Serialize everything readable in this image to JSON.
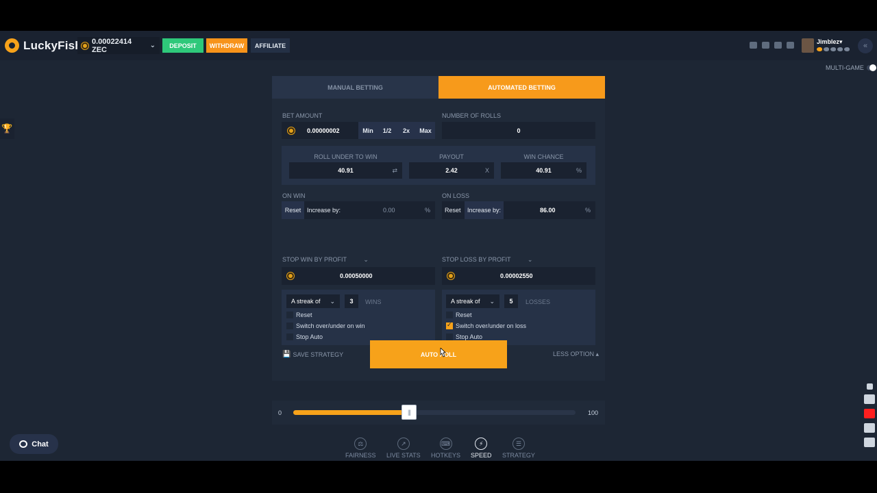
{
  "header": {
    "logo": "LuckyFish",
    "balance": "0.00022414 ZEC",
    "deposit": "DEPOSIT",
    "withdraw": "WITHDRAW",
    "affiliate": "AFFILIATE",
    "username": "Jimblez",
    "multigame": "MULTI-GAME"
  },
  "tabs": {
    "manual": "MANUAL BETTING",
    "auto": "AUTOMATED BETTING"
  },
  "bet": {
    "amount_label": "BET AMOUNT",
    "amount": "0.00000002",
    "quick": [
      "Min",
      "1/2",
      "2x",
      "Max"
    ],
    "rolls_label": "NUMBER OF ROLLS",
    "rolls": "0"
  },
  "roll": {
    "roll_under_label": "ROLL UNDER TO WIN",
    "roll_under": "40.91",
    "payout_label": "PAYOUT",
    "payout": "2.42",
    "payout_suffix": "X",
    "chance_label": "WIN CHANCE",
    "chance": "40.91",
    "chance_suffix": "%"
  },
  "on_win": {
    "label": "ON WIN",
    "reset": "Reset",
    "increase": "Increase by:",
    "value": "0.00",
    "suffix": "%"
  },
  "on_loss": {
    "label": "ON LOSS",
    "reset": "Reset",
    "increase": "Increase by:",
    "value": "86.00",
    "suffix": "%"
  },
  "stop_win": {
    "label": "STOP WIN BY PROFIT",
    "value": "0.00050000"
  },
  "stop_loss": {
    "label": "STOP LOSS BY PROFIT",
    "value": "0.00002550"
  },
  "streak_win": {
    "select": "A streak of",
    "count": "3",
    "unit": "WINS",
    "options": [
      {
        "label": "Reset",
        "checked": false
      },
      {
        "label": "Switch over/under on win",
        "checked": false
      },
      {
        "label": "Stop Auto",
        "checked": false
      }
    ]
  },
  "streak_loss": {
    "select": "A streak of",
    "count": "5",
    "unit": "LOSSES",
    "options": [
      {
        "label": "Reset",
        "checked": false
      },
      {
        "label": "Switch over/under on loss",
        "checked": true
      },
      {
        "label": "Stop Auto",
        "checked": false
      }
    ]
  },
  "save_strategy": "SAVE STRATEGY",
  "less_option": "LESS OPTION",
  "auto_roll": "AUTO ROLL",
  "slider": {
    "min": "0",
    "max": "100",
    "value": 40.91
  },
  "nav": [
    "FAIRNESS",
    "LIVE STATS",
    "HOTKEYS",
    "SPEED",
    "STRATEGY"
  ],
  "chat": "Chat"
}
